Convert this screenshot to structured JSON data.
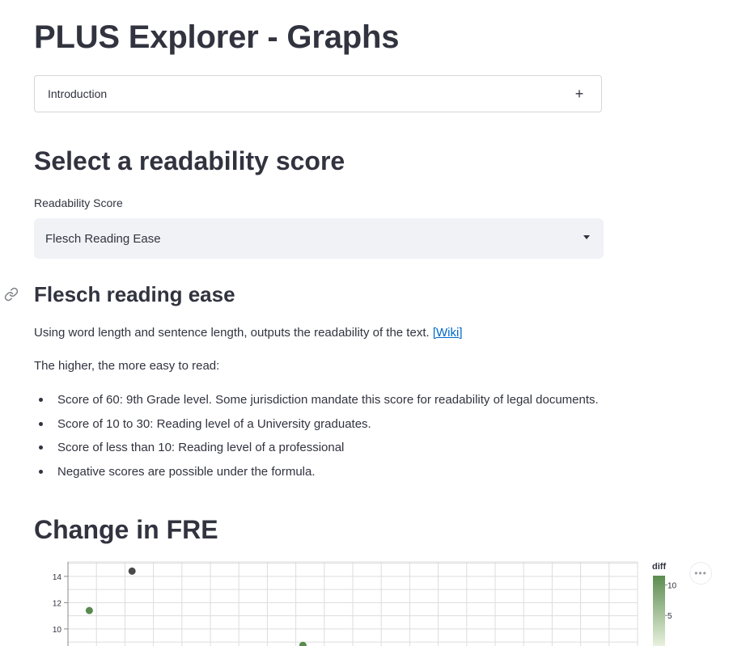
{
  "page": {
    "title": "PLUS Explorer - Graphs"
  },
  "expander": {
    "label": "Introduction",
    "toggle_glyph": "+"
  },
  "readability": {
    "heading": "Select a readability score",
    "select_label": "Readability Score",
    "selected_value": "Flesch Reading Ease"
  },
  "metric": {
    "heading": "Flesch reading ease",
    "description": "Using word length and sentence length, outputs the readability of the text.",
    "wiki_link": "[Wiki]",
    "intro_line": "The higher, the more easy to read:",
    "bullets": [
      "Score of 60: 9th Grade level. Some jurisdiction mandate this score for readability of legal documents.",
      "Score of 10 to 30: Reading level of a University graduates.",
      "Score of less than 10: Reading level of a professional",
      "Negative scores are possible under the formula."
    ]
  },
  "change": {
    "heading": "Change in FRE",
    "more_glyph": "•••"
  },
  "colors": {
    "link": "#0068c9",
    "point_dark": "#4a4a4a",
    "point_green": "#5a8a4f",
    "gradient_top": "#5b8c4f",
    "gradient_bottom": "#e8f1de"
  },
  "chart_data": {
    "type": "scatter",
    "title": "",
    "xlabel": "",
    "ylabel": "",
    "y_ticks": [
      10,
      12,
      14
    ],
    "y_visible_range": [
      8.7,
      15.1
    ],
    "x_range": [
      0,
      20
    ],
    "grid": true,
    "points": [
      {
        "x": 0.75,
        "y": 11.4,
        "diff": 9
      },
      {
        "x": 2.25,
        "y": 14.4,
        "diff": 14
      },
      {
        "x": 8.25,
        "y": 8.75,
        "diff": 7
      }
    ],
    "legend": {
      "title": "diff",
      "ticks": [
        10,
        5
      ],
      "range": [
        0,
        11.5
      ],
      "placement": "right"
    }
  }
}
